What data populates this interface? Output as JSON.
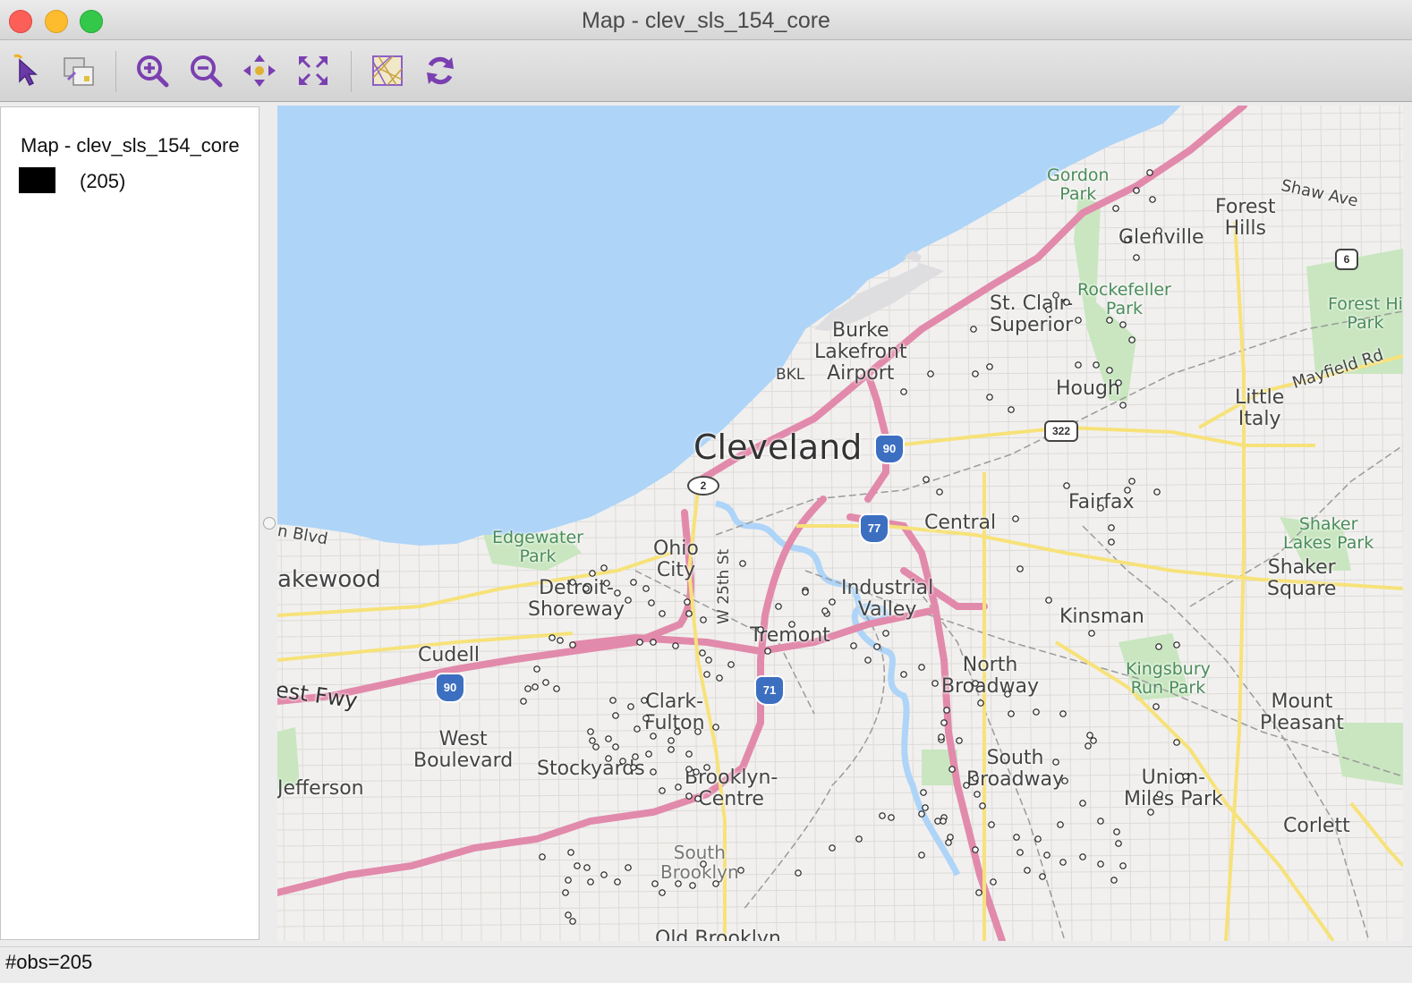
{
  "window": {
    "title": "Map - clev_sls_154_core"
  },
  "toolbar": {
    "buttons": [
      {
        "name": "select-tool",
        "icon": "pointer-arrow-icon"
      },
      {
        "name": "selection-shape",
        "icon": "select-shape-icon"
      },
      {
        "name": "zoom-in",
        "icon": "zoom-in-icon"
      },
      {
        "name": "zoom-out",
        "icon": "zoom-out-icon"
      },
      {
        "name": "pan",
        "icon": "pan-icon"
      },
      {
        "name": "full-extent",
        "icon": "full-extent-icon"
      },
      {
        "name": "basemap",
        "icon": "basemap-icon"
      },
      {
        "name": "refresh",
        "icon": "refresh-icon"
      }
    ],
    "accent": "#7a3fb0"
  },
  "legend": {
    "title": "Map - clev_sls_154_core",
    "items": [
      {
        "color": "#000000",
        "label": "(205)"
      }
    ]
  },
  "map": {
    "water_color": "#aed4f8",
    "highway_color": "#e28aab",
    "labels": {
      "cleveland": "Cleveland",
      "gordon_park": "Gordon\nPark",
      "shaw_ave": "Shaw Ave",
      "forest_hills": "Forest\nHills",
      "glenville": "Glenville",
      "st_clair_superior": "St. Clair-\nSuperior",
      "rockefeller_park": "Rockefeller\nPark",
      "forest_hill_park": "Forest Hi\nPark",
      "burke_lakefront": "Burke\nLakefront\nAirport",
      "bkl": "BKL",
      "hough": "Hough",
      "little_italy": "Little\nItaly",
      "mayfield_rd": "Mayfield Rd",
      "fairfax": "Fairfax",
      "central": "Central",
      "shaker_lakes_park": "Shaker\nLakes Park",
      "shaker_square": "Shaker\nSquare",
      "edgewater_park": "Edgewater\nPark",
      "ohio_city": "Ohio\nCity",
      "detroit_shoreway": "Detroit-\nShoreway",
      "lakewood": "akewood",
      "blvd": "n Blvd",
      "industrial_valley": "Industrial\nValley",
      "kinsman": "Kinsman",
      "tremont": "Tremont",
      "cudell": "Cudell",
      "w25th": "W 25th St",
      "north_broadway": "North\nBroadway",
      "kingsbury_run_park": "Kingsbury\nRun Park",
      "mount_pleasant": "Mount\nPleasant",
      "west_fwy": "est Fwy",
      "clark_fulton": "Clark-\nFulton",
      "west_boulevard": "West\nBoulevard",
      "stockyards": "Stockyards",
      "south_broadway": "South\nBroadway",
      "union_miles_park": "Union-\nMiles Park",
      "jefferson": "Jefferson",
      "brooklyn_centre": "Brooklyn-\nCentre",
      "corlett": "Corlett",
      "south_brooklyn": "South\nBrooklyn",
      "old_brooklyn": "Old Brooklyn"
    },
    "shields": {
      "i90_east": "90",
      "i90_west": "90",
      "i77": "77",
      "i71": "71",
      "us322": "322",
      "us6": "6",
      "rt2": "2"
    }
  },
  "status": {
    "text": "#obs=205"
  }
}
